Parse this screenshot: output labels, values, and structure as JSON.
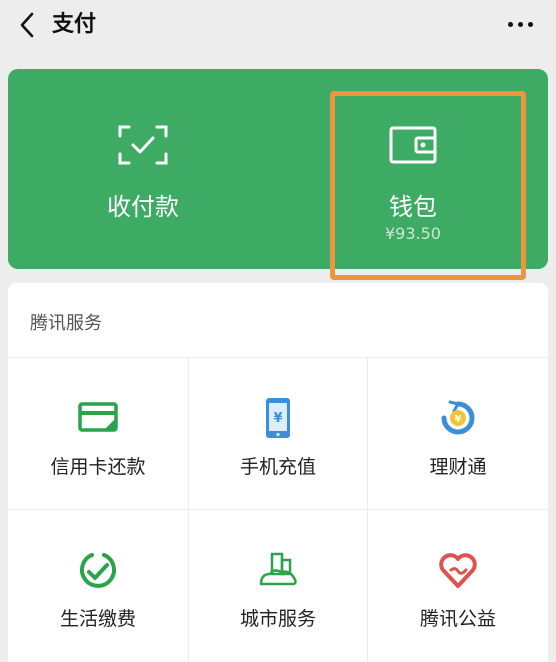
{
  "header": {
    "title": "支付"
  },
  "card": {
    "left_label": "收付款",
    "right_label": "钱包",
    "balance": "¥93.50"
  },
  "services": {
    "section_title": "腾讯服务",
    "items": [
      {
        "label": "信用卡还款",
        "icon": "credit-card-icon"
      },
      {
        "label": "手机充值",
        "icon": "phone-recharge-icon"
      },
      {
        "label": "理财通",
        "icon": "wealth-icon"
      },
      {
        "label": "生活缴费",
        "icon": "utility-payment-icon"
      },
      {
        "label": "城市服务",
        "icon": "city-service-icon"
      },
      {
        "label": "腾讯公益",
        "icon": "charity-heart-icon"
      }
    ]
  },
  "colors": {
    "card_green": "#3dab63",
    "highlight": "#ef9540",
    "icon_green": "#2aa34a",
    "icon_blue": "#3b8fd9",
    "icon_red": "#e0514f"
  }
}
